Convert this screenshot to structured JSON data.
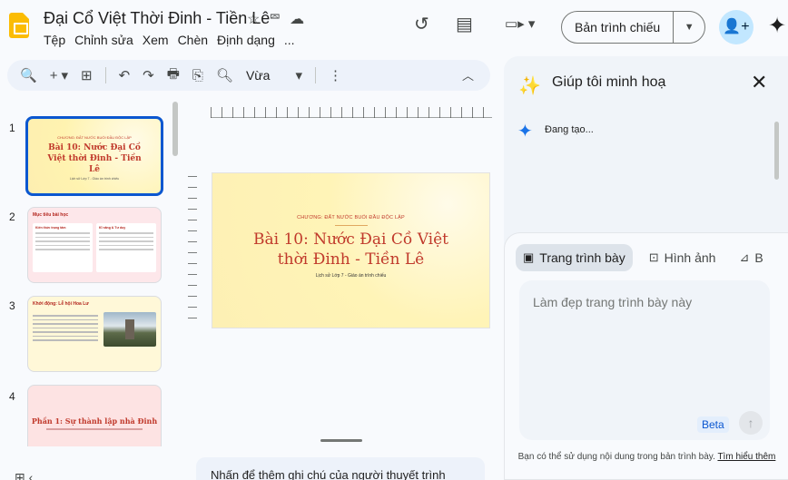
{
  "header": {
    "title": "Đại Cổ Việt Thời Đinh - Tiền Lê",
    "title_icons": [
      "☆",
      "⮹",
      "☁"
    ],
    "menu": [
      "Tệp",
      "Chỉnh sửa",
      "Xem",
      "Chèn",
      "Định dạng",
      "..."
    ],
    "history_icon": "↺",
    "comments_icon": "▤",
    "camera_icon": "▭▸ ▾",
    "present_label": "Bản trình chiếu",
    "present_dropdown": "▼",
    "share_icon": "👤+",
    "gemini_icon": "✦"
  },
  "toolbar": {
    "items": [
      "🔍",
      "+",
      "▾",
      "⊞",
      "↶",
      "↷",
      "🖶",
      "⎘",
      "🔍︎"
    ],
    "zoom": "Vừa",
    "zoom_dd": "▾",
    "more": "⋮",
    "collapse": "︿"
  },
  "slides": [
    {
      "num": "1",
      "sub": "CHƯƠNG: ĐẤT NƯỚC BUỔI ĐẦU ĐỘC LẬP",
      "title": "Bài 10: Nước Đại Cồ Việt thời Đinh - Tiền Lê",
      "small": "Lịch sử Lớp 7 - Giáo án trình chiếu"
    },
    {
      "num": "2",
      "title": "Mục tiêu bài học",
      "col1": "Kiến thức trọng tâm",
      "col2": "Kĩ năng & Tư duy"
    },
    {
      "num": "3",
      "title": "Khởi động: Lễ hội Hoa Lư"
    },
    {
      "num": "4",
      "title": "Phần 1: Sự thành lập nhà Đinh"
    }
  ],
  "main_slide": {
    "sub": "CHƯƠNG: ĐẤT NƯỚC BUỔI ĐẦU ĐỘC LẬP",
    "title_line1": "Bài 10: Nước Đại Cồ Việt",
    "title_line2": "thời Đinh - Tiền Lê",
    "small": "Lịch sử Lớp 7 - Giáo án trình chiếu"
  },
  "notes": {
    "placeholder": "Nhấn để thêm ghi chú của người thuyết trình",
    "grid_icon": "⊞ ‹"
  },
  "panel": {
    "icon": "✨",
    "title": "Giúp tôi minh hoạ",
    "close": "✕",
    "gen_icon": "✦",
    "status": "Đang tạo...",
    "chips": [
      {
        "icon": "▣",
        "label": "Trang trình bày"
      },
      {
        "icon": "⊡",
        "label": "Hình ảnh"
      },
      {
        "icon": "⊿",
        "label": "B"
      }
    ],
    "input_placeholder": "Làm đẹp trang trình bày này",
    "beta": "Beta",
    "send_icon": "↑",
    "disclaimer": "Bạn có thể sử dụng nội dung trong bản trình bày.",
    "disclaimer_link": "Tìm hiểu thêm"
  }
}
